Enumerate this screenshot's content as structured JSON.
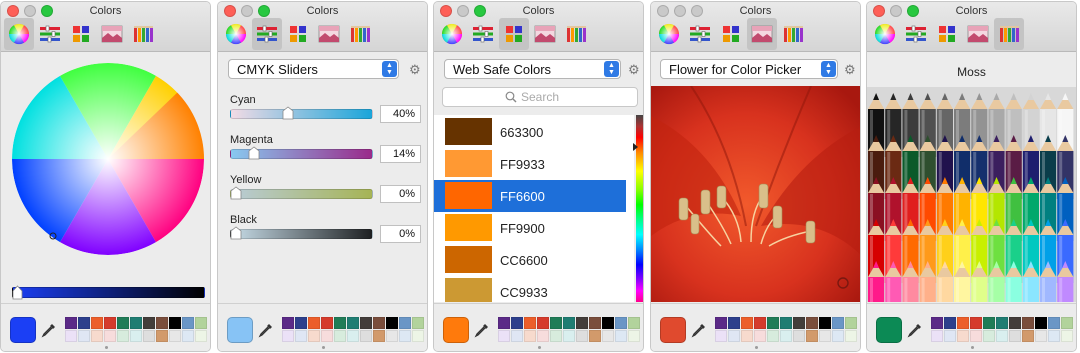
{
  "window_title": "Colors",
  "traffic_lights": [
    "#fe5f57",
    "#c9c9c9",
    "#28c840"
  ],
  "toolbar_icons": [
    "color-wheel-icon",
    "sliders-icon",
    "palettes-icon",
    "image-palettes-icon",
    "pencils-icon"
  ],
  "favorites": [
    [
      "#5b2a87",
      "#2d3f8c",
      "#ec5e2a",
      "#d53b2c",
      "#207c57",
      "#1f7d72",
      "#433d3a",
      "#7a4e3c",
      "#000000",
      "#6a96c6",
      "#b2d39c"
    ],
    [
      "#ebe1f7",
      "#dfe6f4",
      "#f7dacd",
      "#f7dcdc",
      "#d7ecdd",
      "#d9efef",
      "#dedede",
      "#d29a6b",
      "#e7e7e7",
      "#dde8f4",
      "#edf5e6"
    ]
  ],
  "panels": [
    {
      "mode": "color-wheel",
      "selected_tab": 0,
      "current_color": "#1b3ff5",
      "brightness_slider": {
        "from": "#1b3ff5",
        "to": "#000000"
      }
    },
    {
      "mode": "sliders",
      "selected_tab": 1,
      "current_color": "#87c3f5",
      "dropdown": "CMYK Sliders",
      "sliders": [
        {
          "label": "Cyan",
          "value": "40%",
          "level": 0.4,
          "gradient": [
            "#f2dbe5",
            "#1aa5da"
          ]
        },
        {
          "label": "Magenta",
          "value": "14%",
          "level": 0.14,
          "gradient": [
            "#88c9f0",
            "#9a2a8a"
          ]
        },
        {
          "label": "Yellow",
          "value": "0%",
          "level": 0.0,
          "gradient": [
            "#b9ccd8",
            "#a6b455"
          ]
        },
        {
          "label": "Black",
          "value": "0%",
          "level": 0.0,
          "gradient": [
            "#c8dde8",
            "#1e2022"
          ]
        }
      ]
    },
    {
      "mode": "palettes",
      "selected_tab": 2,
      "current_color": "#ff7a0c",
      "dropdown": "Web Safe Colors",
      "search_placeholder": "Search",
      "colors": [
        {
          "name": "663300",
          "hex": "#663300"
        },
        {
          "name": "FF9933",
          "hex": "#ff9933"
        },
        {
          "name": "FF6600",
          "hex": "#ff6600",
          "selected": true
        },
        {
          "name": "FF9900",
          "hex": "#ff9900"
        },
        {
          "name": "CC6600",
          "hex": "#cc6600"
        },
        {
          "name": "CC9933",
          "hex": "#cc9933"
        }
      ]
    },
    {
      "mode": "image",
      "selected_tab": 3,
      "current_color": "#e04a2e",
      "dropdown": "Flower for Color Picker"
    },
    {
      "mode": "pencils",
      "selected_tab": 4,
      "current_color": "#0c8a55",
      "pencil_name": "Moss",
      "pencil_rows": [
        [
          "#111111",
          "#262626",
          "#3c3c3c",
          "#505050",
          "#666666",
          "#7c7c7c",
          "#939393",
          "#a9a9a9",
          "#bfbfbf",
          "#d3d3d3",
          "#e6e6e6",
          "#f6f6f6"
        ],
        [
          "#4a1c0e",
          "#6b2a13",
          "#0b5a2a",
          "#2f4f2f",
          "#20124d",
          "#112e6a",
          "#15306d",
          "#3b1f5e",
          "#5a1c45",
          "#1e1e6e",
          "#0a3d4a",
          "#333366"
        ],
        [
          "#8a1022",
          "#b0122c",
          "#e01e1e",
          "#ff4a00",
          "#ff7a00",
          "#ffb300",
          "#ffe600",
          "#b4e600",
          "#40c040",
          "#00a86b",
          "#008080",
          "#0060c0"
        ],
        [
          "#d60000",
          "#ff3a3a",
          "#ff6a00",
          "#ff9a1a",
          "#ffd01a",
          "#fff04a",
          "#c8f000",
          "#6ee040",
          "#1ad08a",
          "#00c8c0",
          "#00a0e8",
          "#3a6aff"
        ],
        [
          "#ff1a8a",
          "#ff5ab4",
          "#ff8aa0",
          "#ffb08a",
          "#ffd8a0",
          "#fff6a0",
          "#e0ff8a",
          "#a6ffa6",
          "#8affe0",
          "#8ae6ff",
          "#a0b8ff",
          "#c08aff"
        ]
      ]
    }
  ]
}
